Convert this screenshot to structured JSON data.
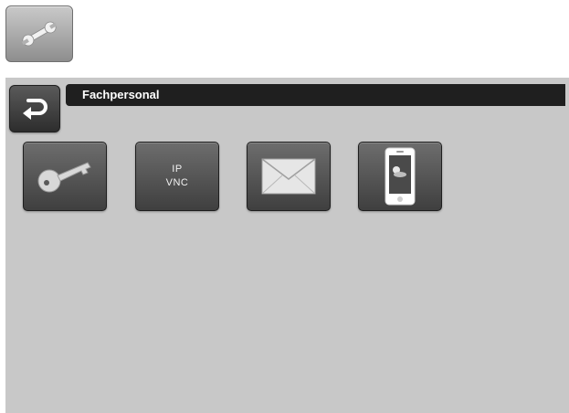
{
  "header": {
    "tools_icon": "wrench-icon"
  },
  "panel": {
    "title": "Fachpersonal",
    "back_icon": "return-arrow-icon",
    "tiles": [
      {
        "icon": "key-icon"
      },
      {
        "icon": "ip-vnc",
        "line1": "IP",
        "line2": "VNC"
      },
      {
        "icon": "envelope-icon"
      },
      {
        "icon": "smartphone-icon"
      }
    ]
  },
  "colors": {
    "panel_bg": "#c8c8c8",
    "title_bar": "#1f1f1f",
    "tile_dark": "#3f3f3f"
  }
}
